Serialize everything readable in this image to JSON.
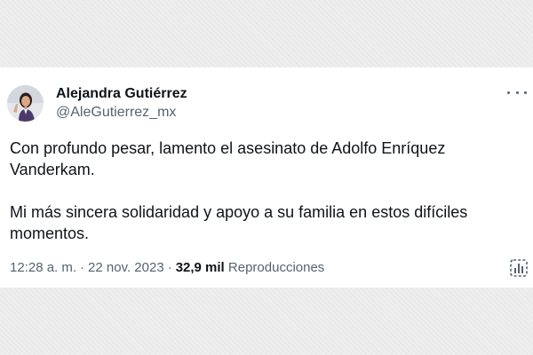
{
  "author": {
    "name": "Alejandra Gutiérrez",
    "handle": "@AleGutierrez_mx",
    "avatar_icon": "profile-photo"
  },
  "tweet": {
    "paragraphs": [
      "Con profundo pesar, lamento el asesinato de Adolfo Enríquez Vanderkam.",
      "Mi más sincera solidaridad y apoyo a su familia en estos difíciles momentos."
    ],
    "time": "12:28 a. m.",
    "separator": "·",
    "date": "22 nov. 2023",
    "views_count": "32,9 mil",
    "views_label": "Reproducciones"
  },
  "icons": {
    "more": "more-options-icon",
    "analytics": "analytics-icon"
  },
  "colors": {
    "text_primary": "#0f1419",
    "text_secondary": "#536471",
    "card_background": "#ffffff",
    "page_background": "#eeeeee"
  }
}
